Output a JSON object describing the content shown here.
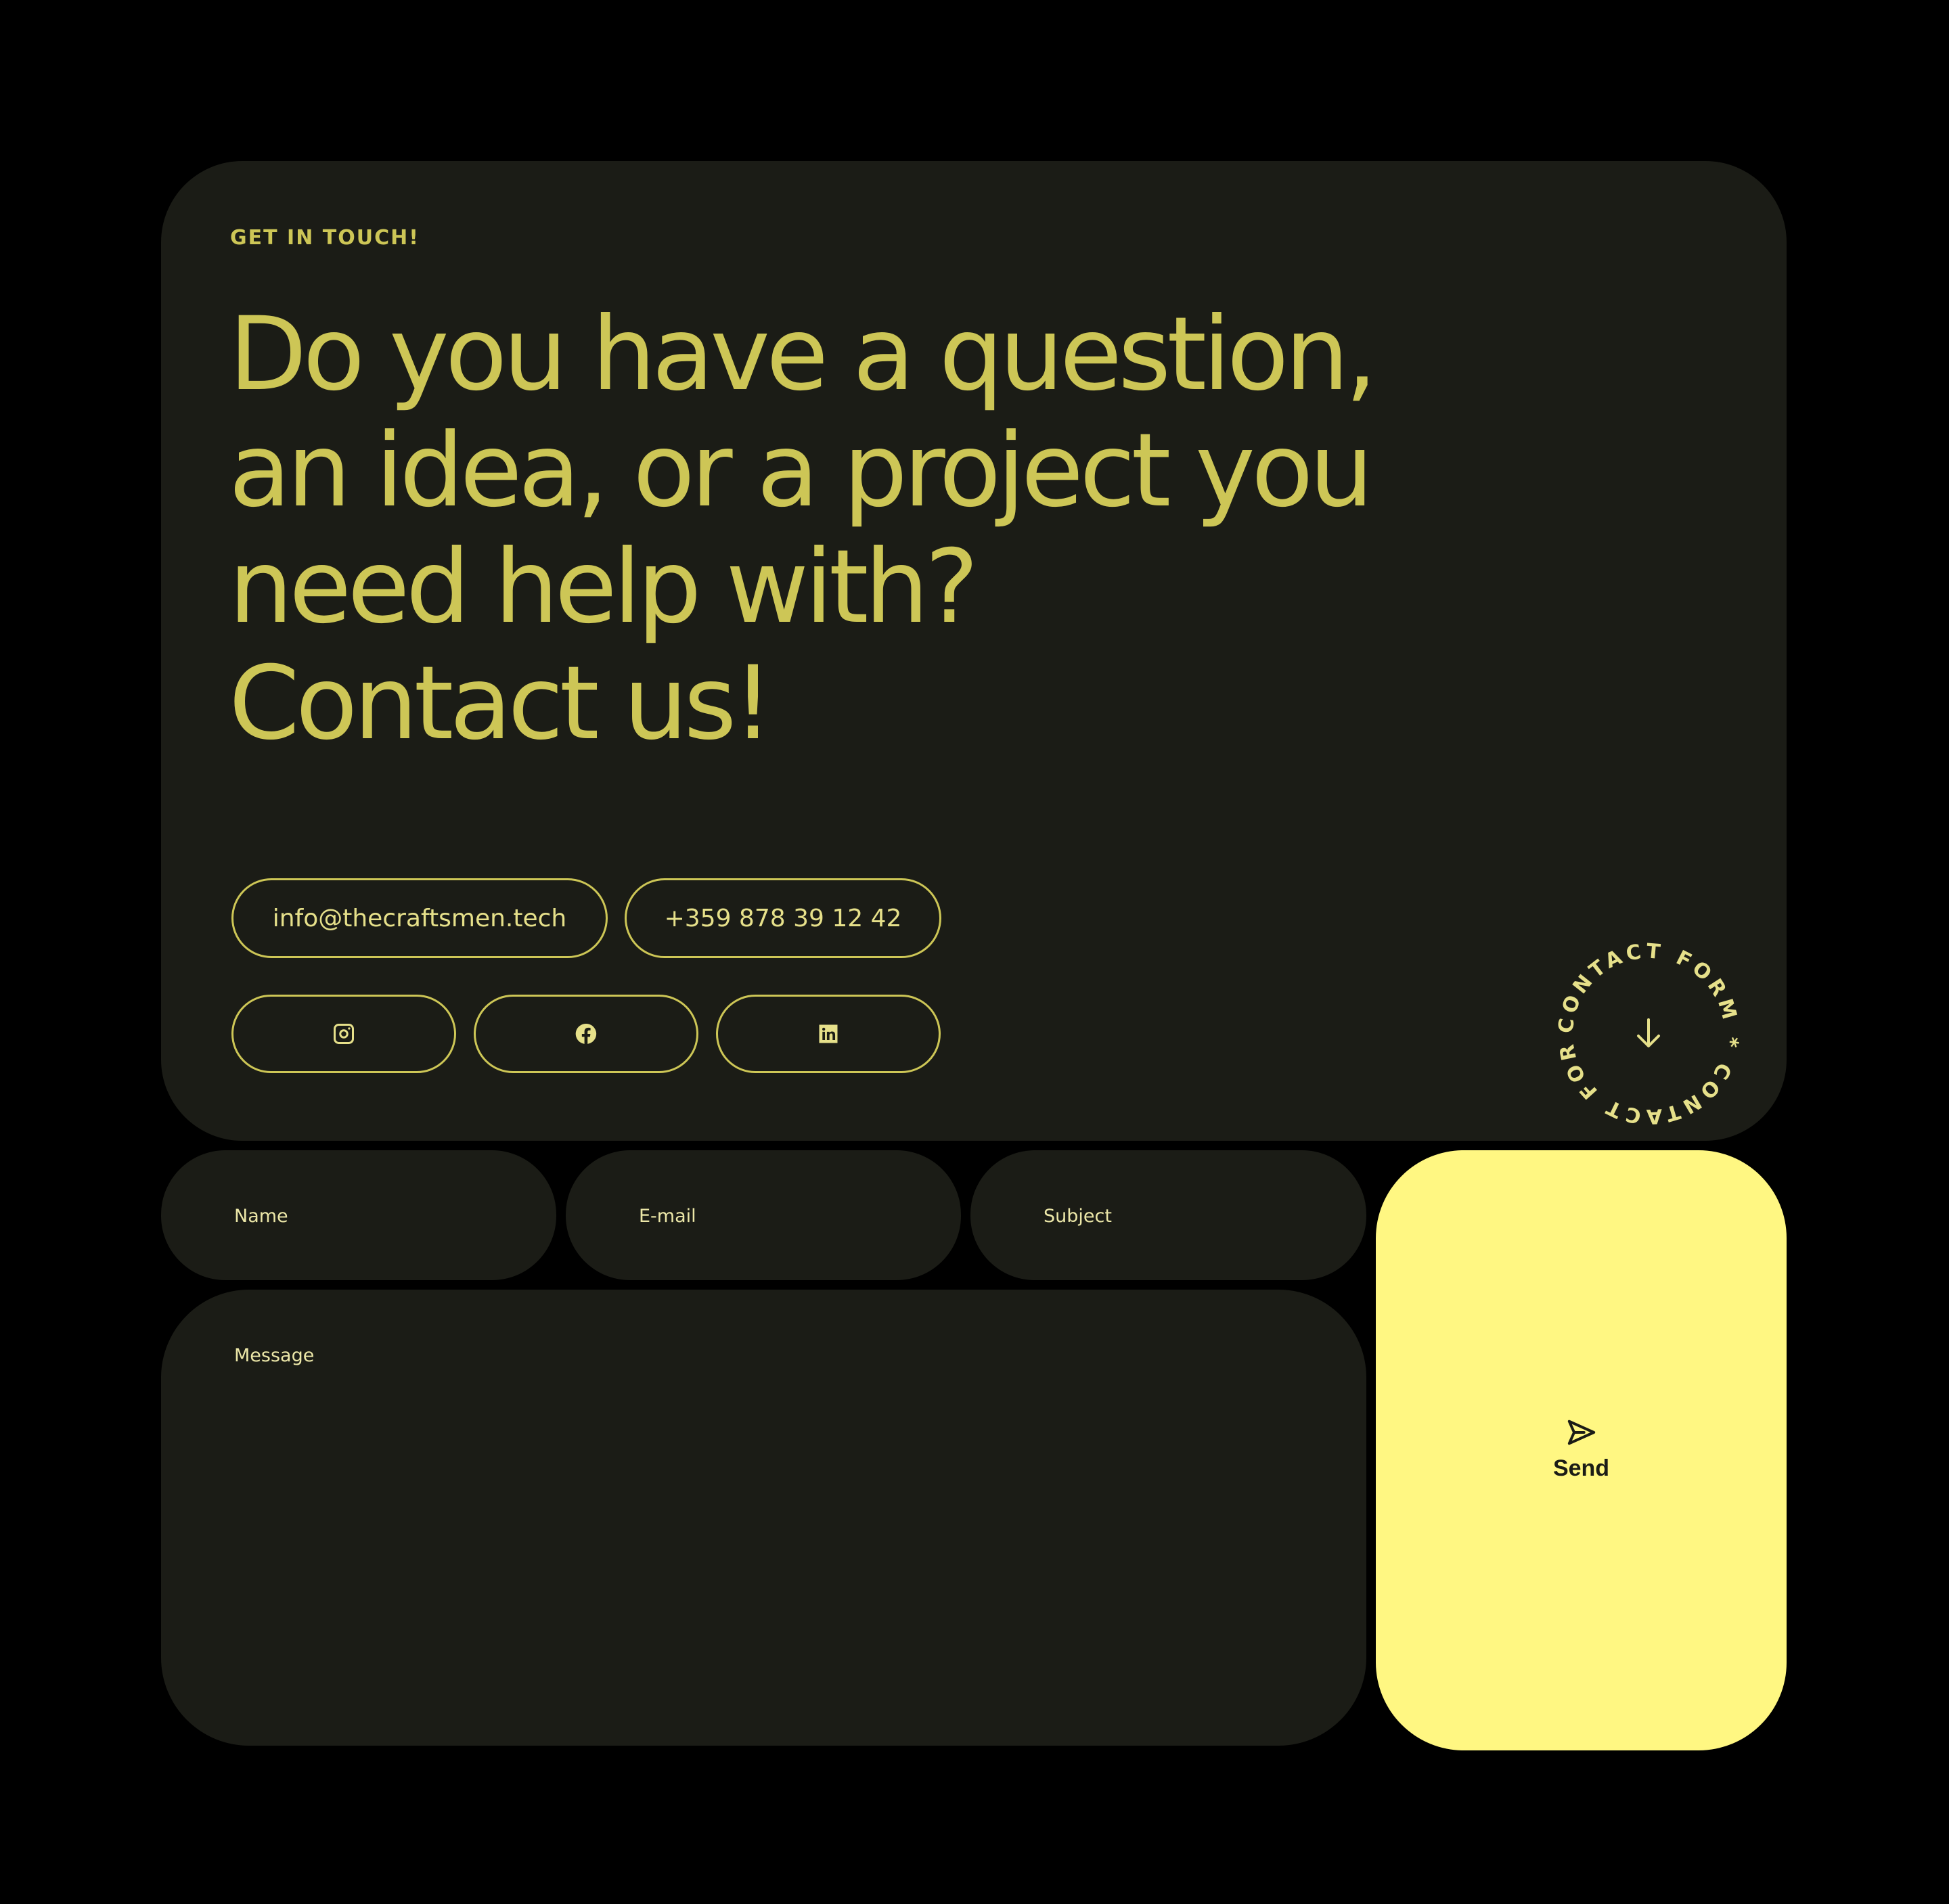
{
  "hero": {
    "eyebrow": "GET IN TOUCH!",
    "headline_lines": [
      "Do you have a question,",
      "an idea, or a project you",
      "need help with?",
      "Contact us!"
    ]
  },
  "contact": {
    "email": "info@thecraftsmen.tech",
    "phone": "+359 878 39 12 42"
  },
  "social": [
    {
      "icon": "instagram-icon"
    },
    {
      "icon": "facebook-icon"
    },
    {
      "icon": "linkedin-icon"
    }
  ],
  "badge": {
    "ring_text": "CONTACT FORM * CONTACT FORM * ",
    "icon": "arrow-down-icon"
  },
  "form": {
    "name_label": "Name",
    "email_label": "E-mail",
    "subject_label": "Subject",
    "message_label": "Message",
    "send_label": "Send",
    "send_icon": "paper-plane-icon"
  },
  "colors": {
    "background": "#000000",
    "card": "#1b1c16",
    "accent": "#cdc656",
    "send_button": "#fff782"
  }
}
